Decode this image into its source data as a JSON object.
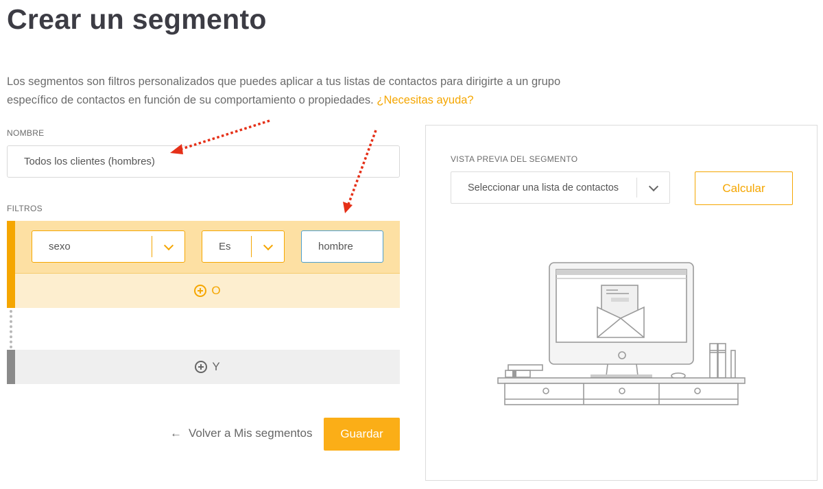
{
  "page": {
    "title": "Crear un segmento",
    "intro_text": "Los segmentos son filtros personalizados que puedes aplicar a tus listas de contactos para dirigirte a un grupo específico de contactos en función de su comportamiento o propiedades.",
    "help_link": "¿Necesitas ayuda?"
  },
  "form": {
    "name_label": "NOMBRE",
    "name_value": "Todos los clientes (hombres)",
    "filters_label": "FILTROS",
    "filter": {
      "field": "sexo",
      "operator": "Es",
      "value": "hombre"
    },
    "or_label": "O",
    "and_label": "Y",
    "back_label": "Volver a Mis segmentos",
    "back_arrow": "←",
    "save_label": "Guardar"
  },
  "preview": {
    "label": "VISTA PREVIA DEL SEGMENTO",
    "list_placeholder": "Seleccionar una lista de contactos",
    "calc_label": "Calcular",
    "illustration": "computer-desk-illustration"
  },
  "colors": {
    "accent": "#f5a600",
    "button": "#fbae17",
    "arrow_annotation": "#e53018",
    "input_focus": "#4a9fd0"
  }
}
